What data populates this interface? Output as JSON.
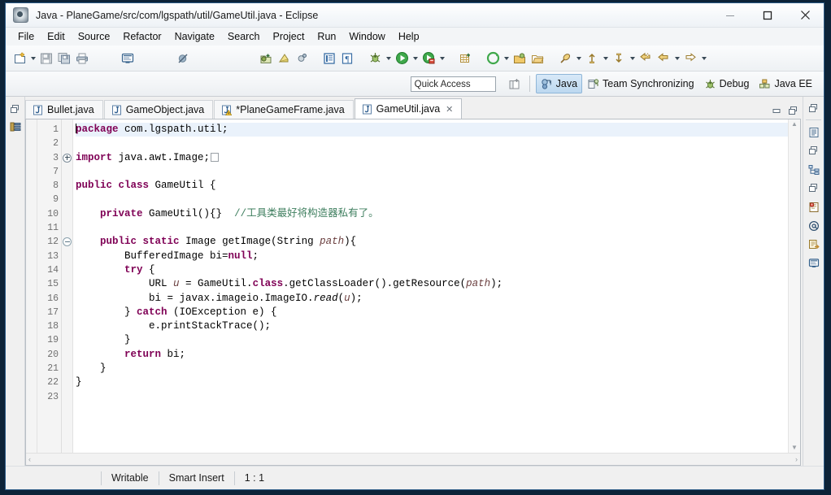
{
  "window": {
    "title": "Java - PlaneGame/src/com/lgspath/util/GameUtil.java - Eclipse",
    "app_icon": "eclipse-icon",
    "minimize_label": "—",
    "maximize_label": "☐",
    "close_label": "✕"
  },
  "menubar": {
    "items": [
      {
        "label": "File"
      },
      {
        "label": "Edit"
      },
      {
        "label": "Source"
      },
      {
        "label": "Refactor"
      },
      {
        "label": "Navigate"
      },
      {
        "label": "Search"
      },
      {
        "label": "Project"
      },
      {
        "label": "Run"
      },
      {
        "label": "Window"
      },
      {
        "label": "Help"
      }
    ]
  },
  "toolbar": {
    "items": [
      {
        "name": "new-wizard-icon",
        "tooltip": "New"
      },
      {
        "name": "new-dropdown-arrow",
        "tooltip": "New menu"
      },
      {
        "name": "save-icon",
        "tooltip": "Save"
      },
      {
        "name": "save-all-icon",
        "tooltip": "Save All"
      },
      {
        "name": "print-icon",
        "tooltip": "Print"
      },
      {
        "name": "toggle-console-icon",
        "tooltip": "Open Console"
      },
      {
        "name": "skip-breakpoints-icon",
        "tooltip": "Skip All Breakpoints"
      },
      {
        "name": "new-java-package-icon",
        "tooltip": "New Java Package"
      },
      {
        "name": "new-java-class-icon",
        "tooltip": "New Java Class"
      },
      {
        "name": "new-java-interface-icon",
        "tooltip": "New Java Interface"
      },
      {
        "name": "open-type-icon",
        "tooltip": "Open Type"
      },
      {
        "name": "open-task-icon",
        "tooltip": "Open Task"
      },
      {
        "name": "debug-icon",
        "tooltip": "Debug"
      },
      {
        "name": "debug-dropdown-arrow",
        "tooltip": "Debug History"
      },
      {
        "name": "run-icon",
        "tooltip": "Run"
      },
      {
        "name": "run-dropdown-arrow",
        "tooltip": "Run History"
      },
      {
        "name": "coverage-icon",
        "tooltip": "Coverage"
      },
      {
        "name": "coverage-dropdown-arrow",
        "tooltip": "Coverage History"
      },
      {
        "name": "new-table-icon",
        "tooltip": "New Table"
      },
      {
        "name": "external-tools-icon",
        "tooltip": "External Tools"
      },
      {
        "name": "external-tools-dropdown-arrow",
        "tooltip": "External Tools History"
      },
      {
        "name": "open-perspective-icon",
        "tooltip": "Open Perspective"
      },
      {
        "name": "open-folder-icon",
        "tooltip": "Open Resource"
      },
      {
        "name": "search-pin-icon",
        "tooltip": "Search"
      },
      {
        "name": "search-dropdown-arrow",
        "tooltip": "Search menu"
      },
      {
        "name": "previous-annotation-icon",
        "tooltip": "Previous Annotation"
      },
      {
        "name": "previous-annotation-dropdown-arrow",
        "tooltip": "Previous Annotation menu"
      },
      {
        "name": "next-annotation-icon",
        "tooltip": "Next Annotation"
      },
      {
        "name": "next-annotation-dropdown-arrow",
        "tooltip": "Next Annotation menu"
      },
      {
        "name": "last-edit-location-icon",
        "tooltip": "Last Edit Location"
      },
      {
        "name": "back-icon",
        "tooltip": "Back"
      },
      {
        "name": "back-dropdown-arrow",
        "tooltip": "Back menu"
      },
      {
        "name": "forward-icon",
        "tooltip": "Forward"
      },
      {
        "name": "forward-dropdown-arrow",
        "tooltip": "Forward menu"
      }
    ]
  },
  "perspective_bar": {
    "quick_access_placeholder": "Quick Access",
    "open_perspective_icon": "open-perspective-icon",
    "perspectives": [
      {
        "label": "Java",
        "icon": "java-perspective-icon",
        "active": true
      },
      {
        "label": "Team Synchronizing",
        "icon": "team-sync-icon",
        "active": false
      },
      {
        "label": "Debug",
        "icon": "debug-perspective-icon",
        "active": false
      },
      {
        "label": "Java EE",
        "icon": "javaee-perspective-icon",
        "active": false
      }
    ]
  },
  "left_strip": {
    "restore_icon": "restore-icon",
    "package_explorer_icon": "package-explorer-icon"
  },
  "right_strip": {
    "icons": [
      "restore-icon",
      "outline-view-icon",
      "restore-icon",
      "hierarchy-view-icon",
      "restore-icon",
      "problems-view-icon",
      "javadoc-view-icon",
      "declaration-view-icon",
      "console-view-icon"
    ]
  },
  "editor": {
    "tabs": [
      {
        "label": "Bullet.java",
        "icon": "java-file-icon",
        "active": false,
        "dirty": false,
        "closable": false
      },
      {
        "label": "GameObject.java",
        "icon": "java-file-icon",
        "active": false,
        "dirty": false,
        "closable": false
      },
      {
        "label": "*PlaneGameFrame.java",
        "icon": "java-file-warning-icon",
        "active": false,
        "dirty": true,
        "closable": false
      },
      {
        "label": "GameUtil.java",
        "icon": "java-file-icon",
        "active": true,
        "dirty": false,
        "closable": true,
        "close_glyph": "✕"
      }
    ],
    "stack_buttons": [
      {
        "name": "minimize-editor-button",
        "glyph": "minimize"
      },
      {
        "name": "maximize-editor-button",
        "glyph": "maximize"
      }
    ],
    "scroll": {
      "up_arrow": "▲",
      "down_arrow": "▼",
      "left_arrow": "‹",
      "right_arrow": "›"
    },
    "code_lines": [
      {
        "num": "1",
        "fold": "none",
        "current": true,
        "caret": true,
        "tokens": [
          {
            "t": "package",
            "c": "kw"
          },
          {
            "t": " com.lgspath.util;",
            "c": "plain"
          }
        ]
      },
      {
        "num": "2",
        "fold": "none",
        "current": false,
        "caret": false,
        "tokens": []
      },
      {
        "num": "3",
        "fold": "plus",
        "current": false,
        "caret": false,
        "tokens": [
          {
            "t": "import",
            "c": "kw"
          },
          {
            "t": " java.awt.Image;",
            "c": "plain"
          },
          {
            "t": "",
            "c": "foldph"
          }
        ]
      },
      {
        "num": "7",
        "fold": "none",
        "current": false,
        "caret": false,
        "tokens": []
      },
      {
        "num": "8",
        "fold": "none",
        "current": false,
        "caret": false,
        "tokens": [
          {
            "t": "public",
            "c": "kw"
          },
          {
            "t": " ",
            "c": "plain"
          },
          {
            "t": "class",
            "c": "kw"
          },
          {
            "t": " GameUtil {",
            "c": "plain"
          }
        ]
      },
      {
        "num": "9",
        "fold": "none",
        "current": false,
        "caret": false,
        "tokens": []
      },
      {
        "num": "10",
        "fold": "none",
        "current": false,
        "caret": false,
        "tokens": [
          {
            "t": "    ",
            "c": "plain"
          },
          {
            "t": "private",
            "c": "kw"
          },
          {
            "t": " GameUtil(){}  ",
            "c": "plain"
          },
          {
            "t": "//工具类最好将构造器私有了。",
            "c": "cmt"
          }
        ]
      },
      {
        "num": "11",
        "fold": "none",
        "current": false,
        "caret": false,
        "tokens": []
      },
      {
        "num": "12",
        "fold": "minus",
        "current": false,
        "caret": false,
        "tokens": [
          {
            "t": "    ",
            "c": "plain"
          },
          {
            "t": "public",
            "c": "kw"
          },
          {
            "t": " ",
            "c": "plain"
          },
          {
            "t": "static",
            "c": "kw"
          },
          {
            "t": " Image getImage(String ",
            "c": "plain"
          },
          {
            "t": "path",
            "c": "par"
          },
          {
            "t": "){",
            "c": "plain"
          }
        ]
      },
      {
        "num": "13",
        "fold": "none",
        "current": false,
        "caret": false,
        "tokens": [
          {
            "t": "        BufferedImage bi=",
            "c": "plain"
          },
          {
            "t": "null",
            "c": "kw"
          },
          {
            "t": ";",
            "c": "plain"
          }
        ]
      },
      {
        "num": "14",
        "fold": "none",
        "current": false,
        "caret": false,
        "tokens": [
          {
            "t": "        ",
            "c": "plain"
          },
          {
            "t": "try",
            "c": "kw"
          },
          {
            "t": " {",
            "c": "plain"
          }
        ]
      },
      {
        "num": "15",
        "fold": "none",
        "current": false,
        "caret": false,
        "tokens": [
          {
            "t": "            URL ",
            "c": "plain"
          },
          {
            "t": "u",
            "c": "par"
          },
          {
            "t": " = GameUtil.",
            "c": "plain"
          },
          {
            "t": "class",
            "c": "kw"
          },
          {
            "t": ".getClassLoader().getResource(",
            "c": "plain"
          },
          {
            "t": "path",
            "c": "par"
          },
          {
            "t": ");",
            "c": "plain"
          }
        ]
      },
      {
        "num": "16",
        "fold": "none",
        "current": false,
        "caret": false,
        "tokens": [
          {
            "t": "            bi = javax.imageio.ImageIO.",
            "c": "plain"
          },
          {
            "t": "read",
            "c": "stat"
          },
          {
            "t": "(",
            "c": "plain"
          },
          {
            "t": "u",
            "c": "par"
          },
          {
            "t": ");",
            "c": "plain"
          }
        ]
      },
      {
        "num": "17",
        "fold": "none",
        "current": false,
        "caret": false,
        "tokens": [
          {
            "t": "        } ",
            "c": "plain"
          },
          {
            "t": "catch",
            "c": "kw"
          },
          {
            "t": " (IOException e) {",
            "c": "plain"
          }
        ]
      },
      {
        "num": "18",
        "fold": "none",
        "current": false,
        "caret": false,
        "tokens": [
          {
            "t": "            e.printStackTrace();",
            "c": "plain"
          }
        ]
      },
      {
        "num": "19",
        "fold": "none",
        "current": false,
        "caret": false,
        "tokens": [
          {
            "t": "        }",
            "c": "plain"
          }
        ]
      },
      {
        "num": "20",
        "fold": "none",
        "current": false,
        "caret": false,
        "tokens": [
          {
            "t": "        ",
            "c": "plain"
          },
          {
            "t": "return",
            "c": "kw"
          },
          {
            "t": " bi;",
            "c": "plain"
          }
        ]
      },
      {
        "num": "21",
        "fold": "none",
        "current": false,
        "caret": false,
        "tokens": [
          {
            "t": "    }",
            "c": "plain"
          }
        ]
      },
      {
        "num": "22",
        "fold": "none",
        "current": false,
        "caret": false,
        "tokens": [
          {
            "t": "}",
            "c": "plain"
          }
        ]
      },
      {
        "num": "23",
        "fold": "none",
        "current": false,
        "caret": false,
        "tokens": []
      }
    ]
  },
  "statusbar": {
    "writable": "Writable",
    "insert_mode": "Smart Insert",
    "position": "1 : 1"
  },
  "colors": {
    "keyword": "#7f0055",
    "comment": "#3f7f5f",
    "parameter": "#6a3e3e",
    "current_line": "#eaf2fb",
    "tab_active_bg": "#ffffff",
    "perspective_active_bg": "#bcd8f0",
    "desktop": "#0d2338"
  }
}
